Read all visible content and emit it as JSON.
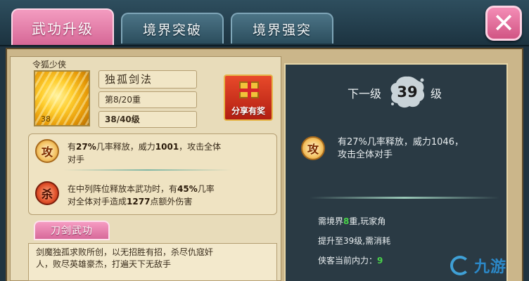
{
  "tabs": [
    {
      "label": "武功升级",
      "active": true
    },
    {
      "label": "境界突破",
      "active": false
    },
    {
      "label": "境界强突",
      "active": false
    }
  ],
  "close_icon": "close-x-icon",
  "hero": {
    "name": "令狐少侠"
  },
  "skill": {
    "icon": "golden-sword-aura-icon",
    "icon_level": "38",
    "name": "独孤剑法",
    "tier": "第8/20重",
    "level": "38/40级"
  },
  "share_button": {
    "label": "分享有奖",
    "icon": "gift-box-icon"
  },
  "effects": [
    {
      "badge": "攻",
      "line1": {
        "pre": "有",
        "val": "27%",
        "mid": "几率释放，威力",
        "val2": "1001",
        "post": "，攻击全体"
      },
      "line2": "对手"
    },
    {
      "badge": "杀",
      "line1": {
        "pre": "在中列阵位释放本武功时，有",
        "val": "45%",
        "post": "几率"
      },
      "line2": {
        "pre": "对全体对手造成",
        "val": "1277",
        "post": "点额外伤害"
      }
    }
  ],
  "section_tab": "刀剑武功",
  "description": {
    "line1": "剑魔独孤求败所创，以无招胜有招，杀尽仇寇奸",
    "line2": "人，败尽英雄豪杰，打遍天下无敌手"
  },
  "next_level": {
    "prefix": "下一级",
    "value": "39",
    "suffix": "级",
    "badge": "攻",
    "effect_line1": "有27%几率释放，威力1046，",
    "effect_line2": "攻击全体对手"
  },
  "requirements": {
    "req1_pre": "需境界",
    "req1_val": "8",
    "req1_post": "重,玩家角",
    "req2": "提升至39级,需消耗",
    "req3_pre": "侠客当前内力：",
    "req3_val": "9"
  },
  "watermark": {
    "text": "九游"
  },
  "colors": {
    "active_tab": "#e07aa6",
    "tab": "#3d6475",
    "right_panel": "#2a3a44",
    "parchment": "#e8dcba",
    "highlight_green": "#49d14a"
  }
}
